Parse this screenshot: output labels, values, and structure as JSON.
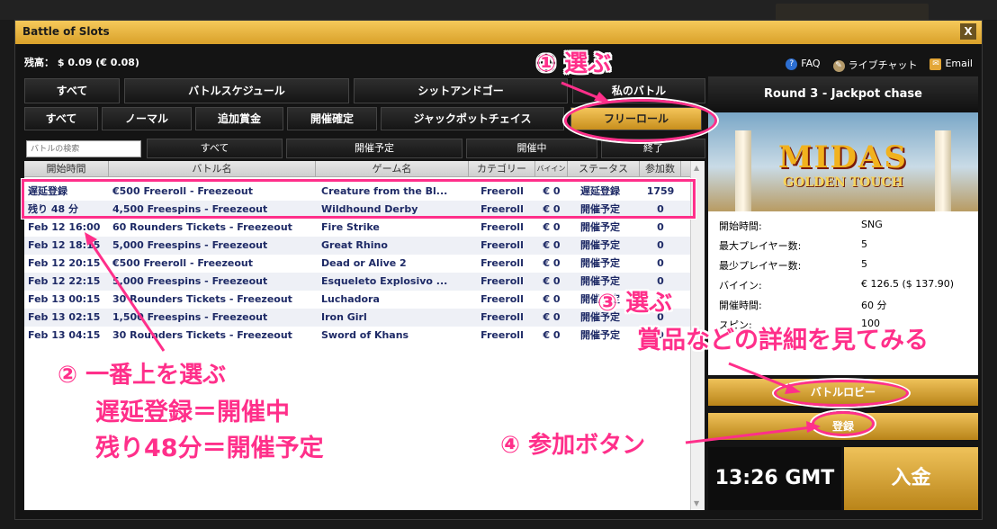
{
  "window": {
    "title": "Battle of Slots",
    "close": "X"
  },
  "balance": "残高： $ 0.09 (€ 0.08)",
  "toplinks": {
    "faq": "FAQ",
    "chat": "ライブチャット",
    "email": "Email"
  },
  "tabs_main": [
    "すべて",
    "バトルスケジュール",
    "シットアンドゴー",
    "私のバトル"
  ],
  "tabs_type": [
    "すべて",
    "ノーマル",
    "追加賞金",
    "開催確定",
    "ジャックポットチェイス",
    "フリーロール"
  ],
  "search": {
    "placeholder": "バトルの検索"
  },
  "status_filters": [
    "すべて",
    "開催予定",
    "開催中",
    "終了"
  ],
  "table": {
    "headers": [
      "開始時間",
      "バトル名",
      "ゲーム名",
      "カテゴリー",
      "バイイン",
      "ステータス",
      "参加数"
    ],
    "rows": [
      [
        "遅延登録",
        "€500 Freeroll - Freezeout",
        "Creature from the Bl...",
        "Freeroll",
        "€ 0",
        "遅延登録",
        "1759"
      ],
      [
        "残り 48 分",
        "4,500 Freespins - Freezeout",
        "Wildhound Derby",
        "Freeroll",
        "€ 0",
        "開催予定",
        "0"
      ],
      [
        "Feb 12 16:00",
        "60 Rounders Tickets - Freezeout",
        "Fire Strike",
        "Freeroll",
        "€ 0",
        "開催予定",
        "0"
      ],
      [
        "Feb 12 18:15",
        "5,000 Freespins - Freezeout",
        "Great Rhino",
        "Freeroll",
        "€ 0",
        "開催予定",
        "0"
      ],
      [
        "Feb 12 20:15",
        "€500 Freeroll - Freezeout",
        "Dead or Alive 2",
        "Freeroll",
        "€ 0",
        "開催予定",
        "0"
      ],
      [
        "Feb 12 22:15",
        "5,000 Freespins - Freezeout",
        "Esqueleto Explosivo ...",
        "Freeroll",
        "€ 0",
        "開催予定",
        "0"
      ],
      [
        "Feb 13 00:15",
        "30 Rounders Tickets - Freezeout",
        "Luchadora",
        "Freeroll",
        "€ 0",
        "開催予定",
        "0"
      ],
      [
        "Feb 13 02:15",
        "1,500 Freespins - Freezeout",
        "Iron Girl",
        "Freeroll",
        "€ 0",
        "開催予定",
        "0"
      ],
      [
        "Feb 13 04:15",
        "30 Rounders Tickets - Freezeout",
        "Sword of Khans",
        "Freeroll",
        "€ 0",
        "開催予定",
        "0"
      ]
    ]
  },
  "detail": {
    "round_title": "Round 3 - Jackpot chase",
    "banner_line1": "MIDAS",
    "banner_line2": "GOLDEN TOUCH",
    "info": [
      [
        "開始時間:",
        "SNG"
      ],
      [
        "最大プレイヤー数:",
        "5"
      ],
      [
        "最少プレイヤー数:",
        "5"
      ],
      [
        "バイイン:",
        "€ 126.5 ($ 137.90)"
      ],
      [
        "開催時間:",
        "60 分"
      ],
      [
        "スピン:",
        "100"
      ]
    ],
    "lobby_button": "バトルロビー",
    "register_button": "登録",
    "clock": "13:26  GMT",
    "deposit": "入金"
  },
  "annotations": {
    "a1": "① 選ぶ",
    "a2_line1": "② 一番上を選ぶ",
    "a2_line2": "遅延登録＝開催中",
    "a2_line3": "残り48分＝開催予定",
    "a3_line1": "③ 選ぶ",
    "a3_line2": "賞品などの詳細を見てみる",
    "a4": "④ 参加ボタン"
  },
  "colors": {
    "accent_gold": "#e0a93a",
    "annotation_pink": "#ff2f8a",
    "row_text": "#1e2a66"
  }
}
